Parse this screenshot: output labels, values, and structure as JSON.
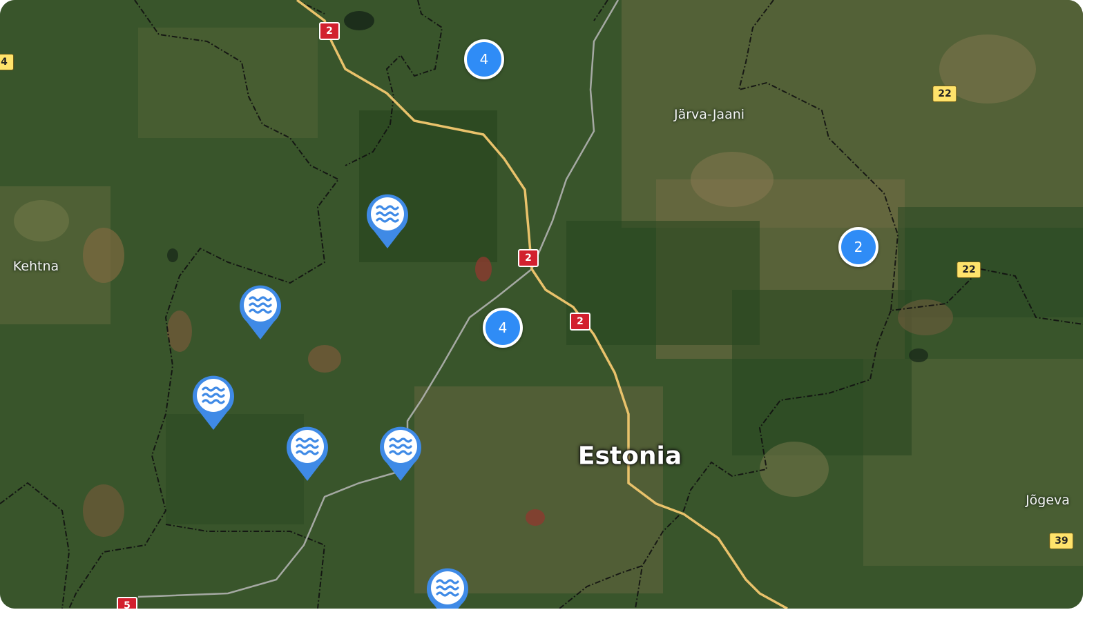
{
  "map": {
    "places": [
      {
        "name": "Järva-Jaani",
        "key": "jarva"
      },
      {
        "name": "Kehtna",
        "key": "kehtna"
      },
      {
        "name": "Jõgeva",
        "key": "jogeva"
      }
    ],
    "country": "Estonia",
    "road_shields": {
      "red": [
        "2",
        "2",
        "2",
        "5"
      ],
      "yellow": [
        "4",
        "22",
        "22",
        "39"
      ]
    },
    "clusters": [
      {
        "count": "4"
      },
      {
        "count": "4"
      },
      {
        "count": "2"
      }
    ],
    "marker_icon": "water-waves-icon",
    "marker_count": 7,
    "colors": {
      "cluster": "#2f8cf6",
      "pin": "#3f8ae6",
      "highway_shield": "#d2202e",
      "regional_shield": "#ffe36b",
      "road": "#e9c26b"
    }
  }
}
